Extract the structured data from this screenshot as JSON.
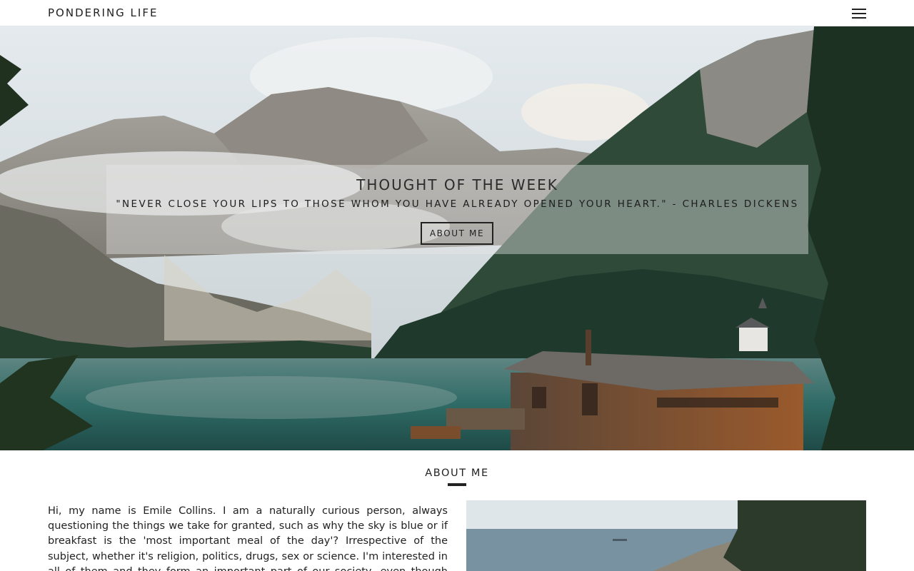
{
  "header": {
    "brand": "PONDERING LIFE",
    "menu_icon": "hamburger-menu-icon"
  },
  "hero": {
    "title": "THOUGHT OF THE WEEK",
    "quote": "\"NEVER CLOSE YOUR LIPS TO THOSE WHOM YOU HAVE ALREADY OPENED YOUR HEART.\" - CHARLES DICKENS",
    "button_label": "ABOUT ME"
  },
  "about": {
    "heading": "ABOUT ME",
    "body": "Hi, my name is Emile Collins. I am a naturally curious person, always questioning the things we take for granted, such as why the sky is blue or if breakfast is the 'most important meal of the day'? Irrespective of the subject, whether it's religion, politics, drugs, sex or science. I'm interested in all of them and they form an important part of our society, even though nothing is"
  },
  "colors": {
    "text": "#222222",
    "panel_overlay": "rgba(230,232,232,0.42)",
    "background": "#ffffff"
  }
}
